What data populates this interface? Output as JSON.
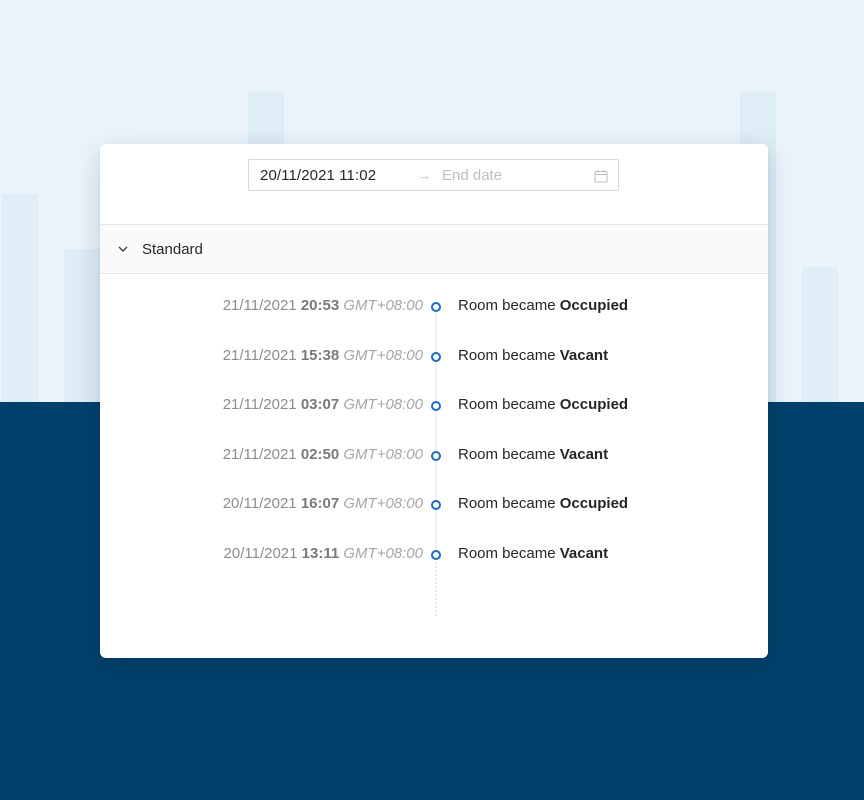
{
  "colors": {
    "page_top_background": "#ecf4fb",
    "page_bottom_background": "#00416b",
    "accent": "#1b6cc7",
    "card_background": "#ffffff"
  },
  "date_range": {
    "start_value": "20/11/2021 11:02",
    "separator_icon": "arrow-right-icon",
    "end_placeholder": "End date",
    "calendar_icon": "calendar-icon"
  },
  "collapse": {
    "icon": "chevron-down-icon",
    "title": "Standard",
    "expanded": true
  },
  "timeline": {
    "events": [
      {
        "date": "21/11/2021",
        "time": "20:53",
        "tz": "GMT+08:00",
        "prefix": "Room became",
        "state": "Occupied"
      },
      {
        "date": "21/11/2021",
        "time": "15:38",
        "tz": "GMT+08:00",
        "prefix": "Room became",
        "state": "Vacant"
      },
      {
        "date": "21/11/2021",
        "time": "03:07",
        "tz": "GMT+08:00",
        "prefix": "Room became",
        "state": "Occupied"
      },
      {
        "date": "21/11/2021",
        "time": "02:50",
        "tz": "GMT+08:00",
        "prefix": "Room became",
        "state": "Vacant"
      },
      {
        "date": "20/11/2021",
        "time": "16:07",
        "tz": "GMT+08:00",
        "prefix": "Room became",
        "state": "Occupied"
      },
      {
        "date": "20/11/2021",
        "time": "13:11",
        "tz": "GMT+08:00",
        "prefix": "Room became",
        "state": "Vacant"
      }
    ]
  }
}
